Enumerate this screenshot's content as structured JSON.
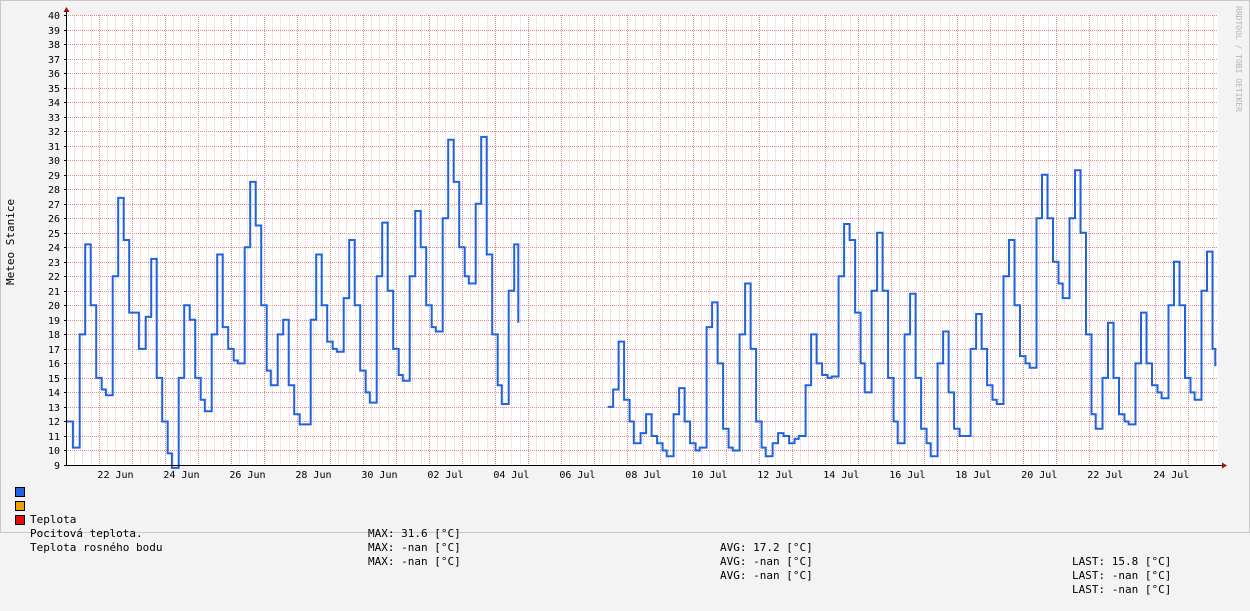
{
  "chart_data": {
    "type": "line",
    "ylabel": "Meteo Stanice",
    "watermark": "RRDTOOL / TOBI OETIKER",
    "ylim": [
      9,
      40
    ],
    "yticks": [
      9,
      10,
      11,
      12,
      13,
      14,
      15,
      16,
      17,
      18,
      19,
      20,
      21,
      22,
      23,
      24,
      25,
      26,
      27,
      28,
      29,
      30,
      31,
      32,
      33,
      34,
      35,
      36,
      37,
      38,
      39,
      40
    ],
    "xlim": [
      "2024-06-21T00:00",
      "2024-07-25T22:00"
    ],
    "xticks": [
      "22 Jun",
      "24 Jun",
      "26 Jun",
      "28 Jun",
      "30 Jun",
      "02 Jul",
      "04 Jul",
      "06 Jul",
      "08 Jul",
      "10 Jul",
      "12 Jul",
      "14 Jul",
      "16 Jul",
      "18 Jul",
      "20 Jul",
      "22 Jul",
      "24 Jul"
    ],
    "colors": {
      "teplota": "#1e64e0",
      "pocitova": "#f0a000",
      "rosny": "#e01010",
      "grid_minor": "#f2c4c4",
      "grid_major": "#e28a8a"
    },
    "series": [
      {
        "name": "Teplota",
        "points": [
          [
            "2024-06-21T00:00",
            12
          ],
          [
            "2024-06-21T05:00",
            10.2
          ],
          [
            "2024-06-21T10:00",
            18
          ],
          [
            "2024-06-21T14:00",
            24.2
          ],
          [
            "2024-06-21T18:00",
            20
          ],
          [
            "2024-06-21T22:00",
            15
          ],
          [
            "2024-06-22T02:00",
            14.2
          ],
          [
            "2024-06-22T05:00",
            13.8
          ],
          [
            "2024-06-22T10:00",
            22
          ],
          [
            "2024-06-22T14:00",
            27.4
          ],
          [
            "2024-06-22T18:00",
            24.5
          ],
          [
            "2024-06-22T22:00",
            19.5
          ],
          [
            "2024-06-23T02:00",
            19.5
          ],
          [
            "2024-06-23T05:00",
            17
          ],
          [
            "2024-06-23T10:00",
            19.2
          ],
          [
            "2024-06-23T14:00",
            23.2
          ],
          [
            "2024-06-23T18:00",
            15
          ],
          [
            "2024-06-23T22:00",
            12
          ],
          [
            "2024-06-24T02:00",
            9.8
          ],
          [
            "2024-06-24T05:00",
            8.8
          ],
          [
            "2024-06-24T10:00",
            15
          ],
          [
            "2024-06-24T14:00",
            20
          ],
          [
            "2024-06-24T18:00",
            19
          ],
          [
            "2024-06-24T22:00",
            15
          ],
          [
            "2024-06-25T02:00",
            13.5
          ],
          [
            "2024-06-25T05:00",
            12.7
          ],
          [
            "2024-06-25T10:00",
            18
          ],
          [
            "2024-06-25T14:00",
            23.5
          ],
          [
            "2024-06-25T18:00",
            18.5
          ],
          [
            "2024-06-25T22:00",
            17
          ],
          [
            "2024-06-26T02:00",
            16.2
          ],
          [
            "2024-06-26T05:00",
            16
          ],
          [
            "2024-06-26T10:00",
            24
          ],
          [
            "2024-06-26T14:00",
            28.5
          ],
          [
            "2024-06-26T18:00",
            25.5
          ],
          [
            "2024-06-26T22:00",
            20
          ],
          [
            "2024-06-27T02:00",
            15.5
          ],
          [
            "2024-06-27T05:00",
            14.5
          ],
          [
            "2024-06-27T10:00",
            18
          ],
          [
            "2024-06-27T14:00",
            19
          ],
          [
            "2024-06-27T18:00",
            14.5
          ],
          [
            "2024-06-27T22:00",
            12.5
          ],
          [
            "2024-06-28T02:00",
            11.8
          ],
          [
            "2024-06-28T05:00",
            11.8
          ],
          [
            "2024-06-28T10:00",
            19
          ],
          [
            "2024-06-28T14:00",
            23.5
          ],
          [
            "2024-06-28T18:00",
            20
          ],
          [
            "2024-06-28T22:00",
            17.5
          ],
          [
            "2024-06-29T02:00",
            17
          ],
          [
            "2024-06-29T05:00",
            16.8
          ],
          [
            "2024-06-29T10:00",
            20.5
          ],
          [
            "2024-06-29T14:00",
            24.5
          ],
          [
            "2024-06-29T18:00",
            20
          ],
          [
            "2024-06-29T22:00",
            15.5
          ],
          [
            "2024-06-30T02:00",
            14
          ],
          [
            "2024-06-30T05:00",
            13.3
          ],
          [
            "2024-06-30T10:00",
            22
          ],
          [
            "2024-06-30T14:00",
            25.7
          ],
          [
            "2024-06-30T18:00",
            21
          ],
          [
            "2024-06-30T22:00",
            17
          ],
          [
            "2024-07-01T02:00",
            15.2
          ],
          [
            "2024-07-01T05:00",
            14.8
          ],
          [
            "2024-07-01T10:00",
            22
          ],
          [
            "2024-07-01T14:00",
            26.5
          ],
          [
            "2024-07-01T18:00",
            24
          ],
          [
            "2024-07-01T22:00",
            20
          ],
          [
            "2024-07-02T02:00",
            18.5
          ],
          [
            "2024-07-02T05:00",
            18.2
          ],
          [
            "2024-07-02T10:00",
            26
          ],
          [
            "2024-07-02T14:00",
            31.4
          ],
          [
            "2024-07-02T18:00",
            28.5
          ],
          [
            "2024-07-02T22:00",
            24
          ],
          [
            "2024-07-03T02:00",
            22
          ],
          [
            "2024-07-03T05:00",
            21.5
          ],
          [
            "2024-07-03T10:00",
            27
          ],
          [
            "2024-07-03T14:00",
            31.6
          ],
          [
            "2024-07-03T18:00",
            23.5
          ],
          [
            "2024-07-03T22:00",
            18
          ],
          [
            "2024-07-04T02:00",
            14.5
          ],
          [
            "2024-07-04T05:00",
            13.2
          ],
          [
            "2024-07-04T10:00",
            21
          ],
          [
            "2024-07-04T14:00",
            24.2
          ],
          [
            "2024-07-04T17:00",
            18.8
          ],
          null,
          [
            "2024-07-07T10:00",
            13
          ],
          [
            "2024-07-07T14:00",
            14.2
          ],
          [
            "2024-07-07T18:00",
            17.5
          ],
          [
            "2024-07-07T22:00",
            13.5
          ],
          [
            "2024-07-08T02:00",
            12
          ],
          [
            "2024-07-08T05:00",
            10.5
          ],
          [
            "2024-07-08T10:00",
            11.2
          ],
          [
            "2024-07-08T14:00",
            12.5
          ],
          [
            "2024-07-08T18:00",
            11
          ],
          [
            "2024-07-08T22:00",
            10.5
          ],
          [
            "2024-07-09T02:00",
            10
          ],
          [
            "2024-07-09T05:00",
            9.6
          ],
          [
            "2024-07-09T10:00",
            12.5
          ],
          [
            "2024-07-09T14:00",
            14.3
          ],
          [
            "2024-07-09T18:00",
            12
          ],
          [
            "2024-07-09T22:00",
            10.5
          ],
          [
            "2024-07-10T02:00",
            10
          ],
          [
            "2024-07-10T05:00",
            10.2
          ],
          [
            "2024-07-10T10:00",
            18.5
          ],
          [
            "2024-07-10T14:00",
            20.2
          ],
          [
            "2024-07-10T18:00",
            16
          ],
          [
            "2024-07-10T22:00",
            11.5
          ],
          [
            "2024-07-11T02:00",
            10.2
          ],
          [
            "2024-07-11T05:00",
            10
          ],
          [
            "2024-07-11T10:00",
            18
          ],
          [
            "2024-07-11T14:00",
            21.5
          ],
          [
            "2024-07-11T18:00",
            17
          ],
          [
            "2024-07-11T22:00",
            12
          ],
          [
            "2024-07-12T02:00",
            10.2
          ],
          [
            "2024-07-12T05:00",
            9.6
          ],
          [
            "2024-07-12T10:00",
            10.5
          ],
          [
            "2024-07-12T14:00",
            11.2
          ],
          [
            "2024-07-12T18:00",
            11
          ],
          [
            "2024-07-12T22:00",
            10.5
          ],
          [
            "2024-07-13T02:00",
            10.8
          ],
          [
            "2024-07-13T05:00",
            11
          ],
          [
            "2024-07-13T10:00",
            14.5
          ],
          [
            "2024-07-13T14:00",
            18
          ],
          [
            "2024-07-13T18:00",
            16
          ],
          [
            "2024-07-13T22:00",
            15.2
          ],
          [
            "2024-07-14T02:00",
            15
          ],
          [
            "2024-07-14T05:00",
            15.1
          ],
          [
            "2024-07-14T10:00",
            22
          ],
          [
            "2024-07-14T14:00",
            25.6
          ],
          [
            "2024-07-14T18:00",
            24.5
          ],
          [
            "2024-07-14T22:00",
            19.5
          ],
          [
            "2024-07-15T02:00",
            16
          ],
          [
            "2024-07-15T05:00",
            14
          ],
          [
            "2024-07-15T10:00",
            21
          ],
          [
            "2024-07-15T14:00",
            25
          ],
          [
            "2024-07-15T18:00",
            21
          ],
          [
            "2024-07-15T22:00",
            15
          ],
          [
            "2024-07-16T02:00",
            12
          ],
          [
            "2024-07-16T05:00",
            10.5
          ],
          [
            "2024-07-16T10:00",
            18
          ],
          [
            "2024-07-16T14:00",
            20.8
          ],
          [
            "2024-07-16T18:00",
            15
          ],
          [
            "2024-07-16T22:00",
            11.5
          ],
          [
            "2024-07-17T02:00",
            10.5
          ],
          [
            "2024-07-17T05:00",
            9.6
          ],
          [
            "2024-07-17T10:00",
            16
          ],
          [
            "2024-07-17T14:00",
            18.2
          ],
          [
            "2024-07-17T18:00",
            14
          ],
          [
            "2024-07-17T22:00",
            11.5
          ],
          [
            "2024-07-18T02:00",
            11
          ],
          [
            "2024-07-18T05:00",
            11
          ],
          [
            "2024-07-18T10:00",
            17
          ],
          [
            "2024-07-18T14:00",
            19.4
          ],
          [
            "2024-07-18T18:00",
            17
          ],
          [
            "2024-07-18T22:00",
            14.5
          ],
          [
            "2024-07-19T02:00",
            13.5
          ],
          [
            "2024-07-19T05:00",
            13.2
          ],
          [
            "2024-07-19T10:00",
            22
          ],
          [
            "2024-07-19T14:00",
            24.5
          ],
          [
            "2024-07-19T18:00",
            20
          ],
          [
            "2024-07-19T22:00",
            16.5
          ],
          [
            "2024-07-20T02:00",
            16
          ],
          [
            "2024-07-20T05:00",
            15.7
          ],
          [
            "2024-07-20T10:00",
            26
          ],
          [
            "2024-07-20T14:00",
            29
          ],
          [
            "2024-07-20T18:00",
            26
          ],
          [
            "2024-07-20T22:00",
            23
          ],
          [
            "2024-07-21T02:00",
            21.5
          ],
          [
            "2024-07-21T05:00",
            20.5
          ],
          [
            "2024-07-21T10:00",
            26
          ],
          [
            "2024-07-21T14:00",
            29.3
          ],
          [
            "2024-07-21T18:00",
            25
          ],
          [
            "2024-07-21T22:00",
            18
          ],
          [
            "2024-07-22T02:00",
            12.5
          ],
          [
            "2024-07-22T05:00",
            11.5
          ],
          [
            "2024-07-22T10:00",
            15
          ],
          [
            "2024-07-22T14:00",
            18.8
          ],
          [
            "2024-07-22T18:00",
            15
          ],
          [
            "2024-07-22T22:00",
            12.5
          ],
          [
            "2024-07-23T02:00",
            12
          ],
          [
            "2024-07-23T05:00",
            11.8
          ],
          [
            "2024-07-23T10:00",
            16
          ],
          [
            "2024-07-23T14:00",
            19.5
          ],
          [
            "2024-07-23T18:00",
            16
          ],
          [
            "2024-07-23T22:00",
            14.5
          ],
          [
            "2024-07-24T02:00",
            14
          ],
          [
            "2024-07-24T05:00",
            13.6
          ],
          [
            "2024-07-24T10:00",
            20
          ],
          [
            "2024-07-24T14:00",
            23
          ],
          [
            "2024-07-24T18:00",
            20
          ],
          [
            "2024-07-24T22:00",
            15
          ],
          [
            "2024-07-25T02:00",
            14
          ],
          [
            "2024-07-25T05:00",
            13.5
          ],
          [
            "2024-07-25T10:00",
            21
          ],
          [
            "2024-07-25T14:00",
            23.7
          ],
          [
            "2024-07-25T18:00",
            17
          ],
          [
            "2024-07-25T20:00",
            15.8
          ]
        ]
      },
      {
        "name": "Pocitová teplota.",
        "points": []
      },
      {
        "name": "Teplota rosného bodu",
        "points": []
      }
    ]
  },
  "legend": [
    {
      "name": "Teplota",
      "max": "MAX: 31.6 [°C]",
      "avg": "AVG: 17.2 [°C]",
      "last": "LAST: 15.8 [°C]"
    },
    {
      "name": "Pocitová teplota.",
      "max": "MAX: -nan [°C]",
      "avg": "AVG: -nan [°C]",
      "last": "LAST: -nan [°C]"
    },
    {
      "name": "Teplota rosného bodu",
      "max": "MAX: -nan [°C]",
      "avg": "AVG: -nan [°C]",
      "last": "LAST: -nan [°C]"
    }
  ]
}
